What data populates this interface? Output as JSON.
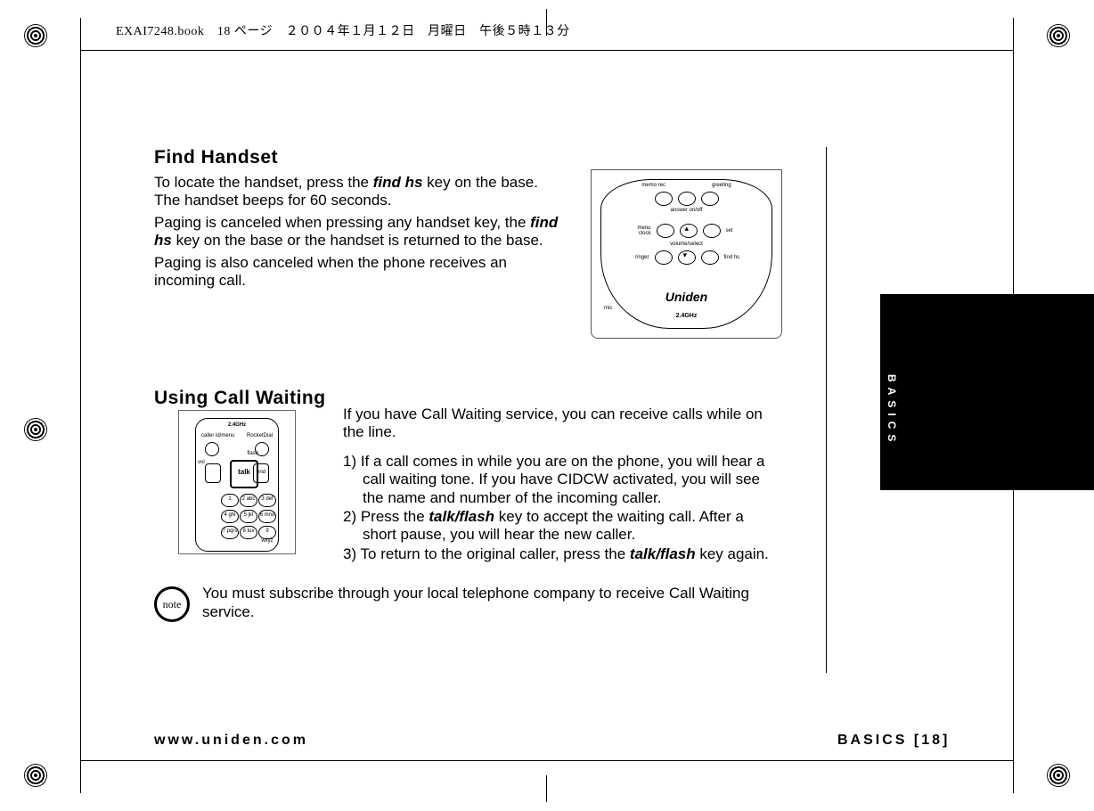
{
  "crop_header": "EXAI7248.book　18 ページ　２００４年１月１２日　月曜日　午後５時１３分",
  "section1": {
    "title": "Find Handset",
    "p1a": "To locate the handset, press the ",
    "p1b": "find hs",
    "p1c": " key on the base. The handset beeps for 60 seconds.",
    "p2a": "Paging is canceled when pressing any handset key, the ",
    "p2b": "find hs",
    "p2c": " key on the base or the handset is returned to the base.",
    "p3": "Paging is also canceled when the phone receives an incoming call."
  },
  "base_labels": {
    "memo": "memo rec",
    "greeting": "greeting",
    "answer": "answer on/off",
    "menu": "menu",
    "clock": "clock",
    "set": "set",
    "volume": "volume/select",
    "ringer": "ringer",
    "findhs": "find hs",
    "mic": "mic",
    "brand": "Uniden",
    "ghz": "2.4GHz"
  },
  "section2": {
    "title": "Using Call Waiting",
    "intro": "If you have Call Waiting service, you can receive calls while on the line.",
    "l1": "1) If a call comes in while you are on the phone, you will hear a call waiting tone. If you have CIDCW activated, you will see the name and number of the incoming caller.",
    "l2a": "2) Press the ",
    "l2b": "talk/flash",
    "l2c": " key to accept the waiting call. After a short pause, you will hear the new caller.",
    "l3a": "3) To return to the original caller, press the ",
    "l3b": "talk/flash",
    "l3c": " key again."
  },
  "handset_labels": {
    "ghz": "2.4GHz",
    "caller": "caller id/menu",
    "rocket": "RocketDial",
    "talk": "talk",
    "end": "end",
    "vol": "vol",
    "flash": "flash",
    "k1": "1",
    "k2": "2 abc",
    "k3": "3 def",
    "k4": "4 ghi",
    "k5": "5 jkl",
    "k6": "6 mno",
    "k7": "7 pqrs",
    "k8": "8 tuv",
    "k9": "9 wxyz"
  },
  "note": {
    "icon": "note",
    "text": "You must subscribe through your local telephone company to receive Call Waiting service."
  },
  "sidebar": "BASICS",
  "footer": {
    "left": "www.uniden.com",
    "right": "BASICS [18]"
  }
}
